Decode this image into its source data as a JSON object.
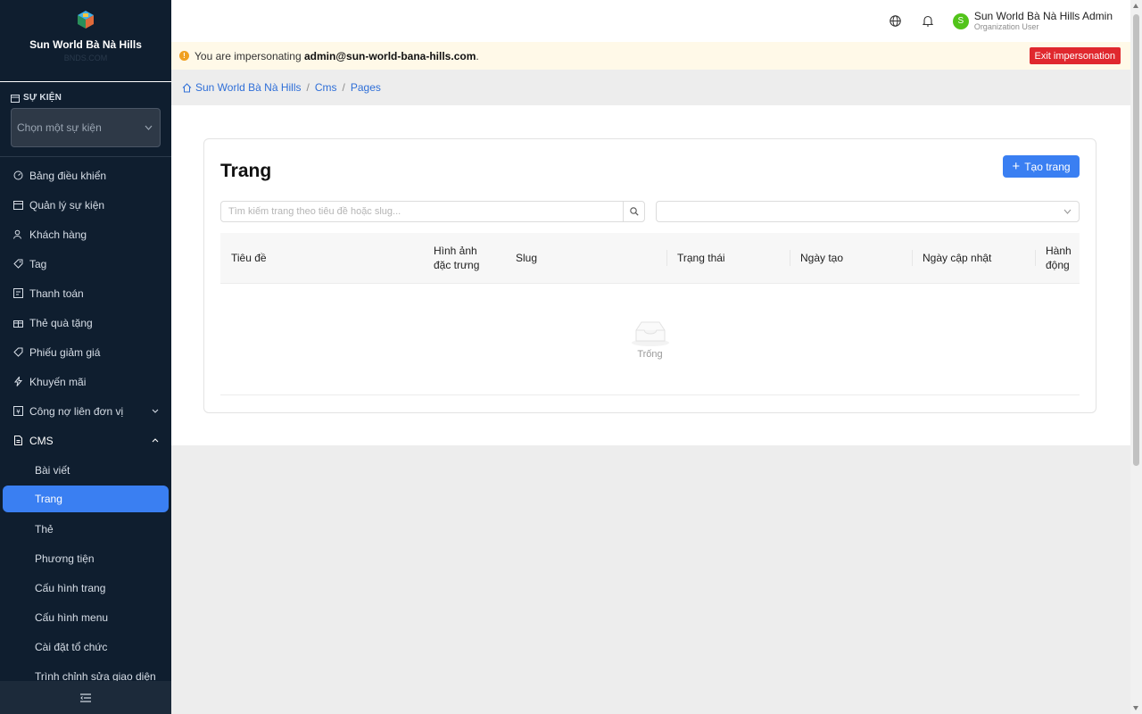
{
  "brand": {
    "name": "Sun World Bà Nà Hills",
    "sub": "BNDS.COM"
  },
  "event": {
    "section_label": "SỰ KIỆN",
    "select_placeholder": "Chọn một sự kiện"
  },
  "nav": {
    "items": [
      {
        "label": "Bảng điều khiển",
        "icon": "dashboard-icon"
      },
      {
        "label": "Quản lý sự kiện",
        "icon": "calendar-icon"
      },
      {
        "label": "Khách hàng",
        "icon": "users-icon"
      },
      {
        "label": "Tag",
        "icon": "tag-icon"
      },
      {
        "label": "Thanh toán",
        "icon": "payment-icon"
      },
      {
        "label": "Thẻ quà tặng",
        "icon": "gift-icon"
      },
      {
        "label": "Phiếu giảm giá",
        "icon": "coupon-icon"
      },
      {
        "label": "Khuyến mãi",
        "icon": "lightning-icon"
      },
      {
        "label": "Công nợ liên đơn vị",
        "icon": "ledger-icon"
      },
      {
        "label": "CMS",
        "icon": "file-icon"
      }
    ],
    "cms_children": [
      "Bài viết",
      "Trang",
      "Thẻ",
      "Phương tiện",
      "Cấu hình trang",
      "Cấu hình menu",
      "Cài đặt tổ chức",
      "Trình chỉnh sửa giao diện"
    ]
  },
  "header": {
    "user_name": "Sun World Bà Nà Hills Admin",
    "user_role": "Organization User",
    "avatar_letter": "S"
  },
  "banner": {
    "prefix": "You are impersonating ",
    "email": "admin@sun-world-bana-hills.com",
    "suffix": ".",
    "exit_label": "Exit impersonation"
  },
  "breadcrumb": [
    "Sun World Bà Nà Hills",
    "Cms",
    "Pages"
  ],
  "page": {
    "title": "Trang",
    "create_label": "Tạo trang",
    "search_placeholder": "Tìm kiếm trang theo tiêu đề hoặc slug...",
    "columns": [
      "Tiêu đề",
      "Hình ảnh đặc trưng",
      "Slug",
      "Trạng thái",
      "Ngày tạo",
      "Ngày cập nhật",
      "Hành động"
    ],
    "empty_text": "Trống"
  }
}
